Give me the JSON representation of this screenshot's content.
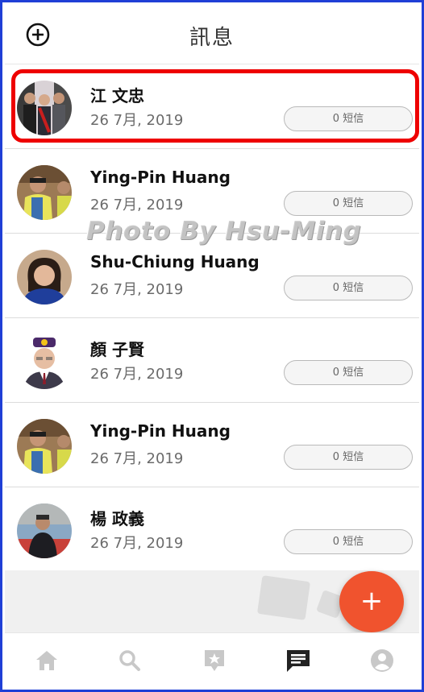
{
  "header": {
    "title": "訊息"
  },
  "contacts": [
    {
      "name": "江 文忠",
      "date": "26 7月, 2019",
      "sms": "0 短信"
    },
    {
      "name": "Ying-Pin Huang",
      "date": "26 7月, 2019",
      "sms": "0 短信"
    },
    {
      "name": "Shu-Chiung Huang",
      "date": "26 7月, 2019",
      "sms": "0 短信"
    },
    {
      "name": "顏 子賢",
      "date": "26 7月, 2019",
      "sms": "0 短信"
    },
    {
      "name": "Ying-Pin Huang",
      "date": "26 7月, 2019",
      "sms": "0 短信"
    },
    {
      "name": "楊 政義",
      "date": "26 7月, 2019",
      "sms": "0 短信"
    }
  ],
  "watermark": "Photo By Hsu-Ming",
  "fab": {
    "label": "+"
  },
  "nav": [
    "home-icon",
    "search-icon",
    "favorites-icon",
    "messages-icon",
    "profile-icon"
  ],
  "colors": {
    "accent": "#f0532e",
    "highlight": "#ee0000",
    "active_nav": "#222222",
    "inactive_nav": "#c8c8c8"
  }
}
